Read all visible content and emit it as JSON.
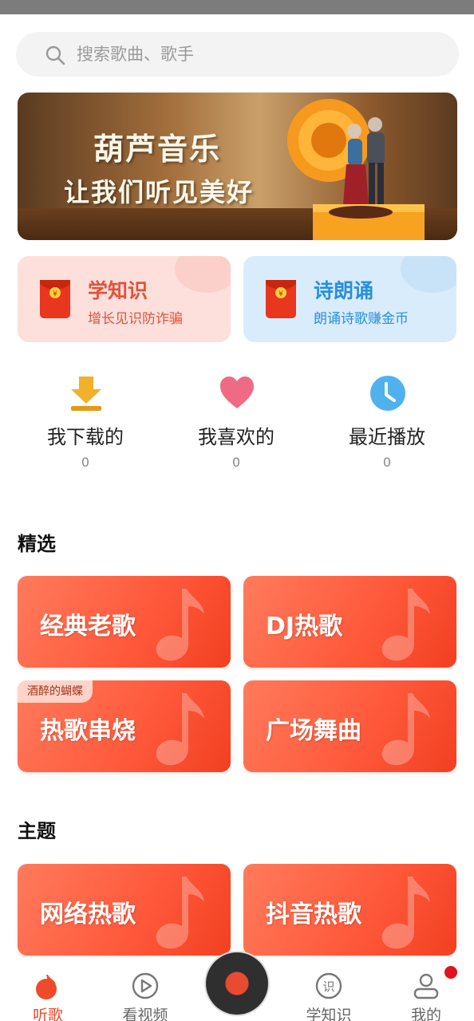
{
  "search": {
    "placeholder": "搜索歌曲、歌手"
  },
  "banner": {
    "line1": "葫芦音乐",
    "line2": "让我们听见美好"
  },
  "promos": [
    {
      "title": "学知识",
      "subtitle": "增长见识防诈骗"
    },
    {
      "title": "诗朗诵",
      "subtitle": "朗诵诗歌赚金币"
    }
  ],
  "quick_stats": [
    {
      "label": "我下载的",
      "count": "0",
      "icon": "download-icon"
    },
    {
      "label": "我喜欢的",
      "count": "0",
      "icon": "heart-icon"
    },
    {
      "label": "最近播放",
      "count": "0",
      "icon": "clock-icon"
    }
  ],
  "featured": {
    "title": "精选",
    "cards": [
      {
        "label": "经典老歌"
      },
      {
        "label": "DJ热歌"
      },
      {
        "label": "热歌串烧",
        "tag": "酒醉的蝴蝶"
      },
      {
        "label": "广场舞曲"
      }
    ]
  },
  "themes": {
    "title": "主题",
    "cards": [
      {
        "label": "网络热歌"
      },
      {
        "label": "抖音热歌"
      }
    ]
  },
  "tabbar": {
    "items": [
      {
        "label": "听歌",
        "icon": "music-note-icon",
        "active": true
      },
      {
        "label": "看视频",
        "icon": "video-play-icon",
        "active": false
      },
      {
        "label": "学知识",
        "icon": "knowledge-icon",
        "active": false
      },
      {
        "label": "我的",
        "icon": "user-icon",
        "active": false
      }
    ],
    "center_icon": "vinyl-disc-icon",
    "notification_dot": true
  },
  "colors": {
    "accent": "#ef4a2c",
    "card_gradient_start": "#ff7b5c",
    "card_gradient_end": "#f24021",
    "promo_left_bg": "#fde0dc",
    "promo_right_bg": "#d9ecfb"
  }
}
